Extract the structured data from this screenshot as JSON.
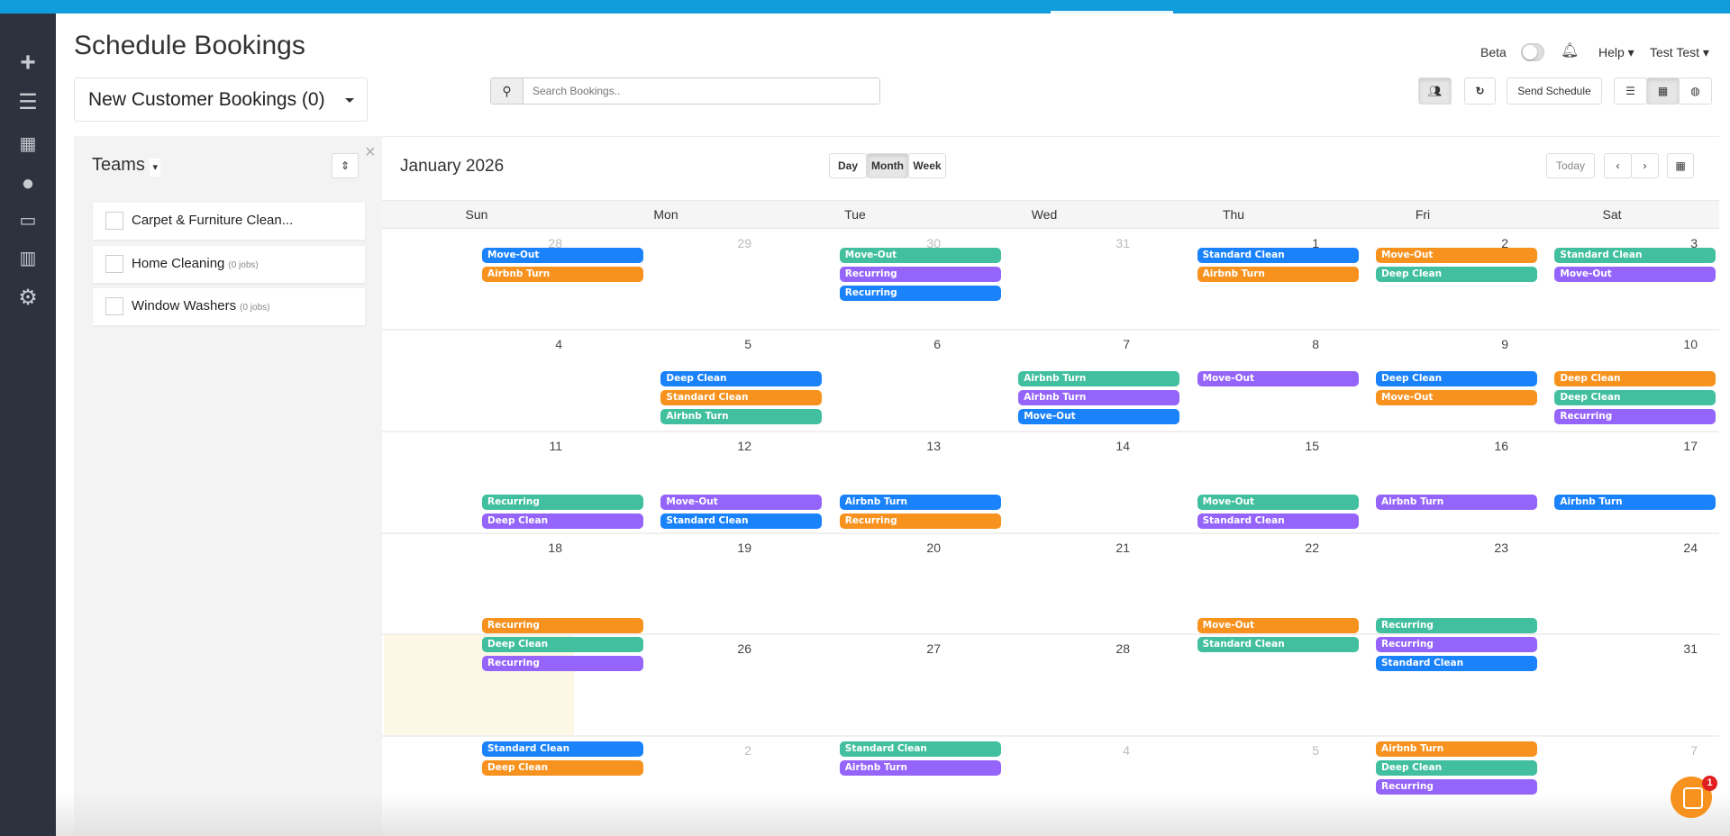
{
  "header": {
    "title": "Schedule Bookings",
    "beta_label": "Beta",
    "help_label": "Help",
    "user_label": "Test Test"
  },
  "new_bookings": {
    "label": "New Customer Bookings (0)"
  },
  "search": {
    "placeholder": "Search Bookings.."
  },
  "toolbar": {
    "send_schedule": "Send Schedule"
  },
  "teams": {
    "title": "Teams",
    "items": [
      {
        "name": "Carpet & Furniture Clean...",
        "jobs": ""
      },
      {
        "name": "Home Cleaning",
        "jobs": "(0 jobs)"
      },
      {
        "name": "Window Washers",
        "jobs": "(0 jobs)"
      }
    ]
  },
  "calendar": {
    "month_title": "January 2026",
    "views": [
      "Day",
      "Month",
      "Week"
    ],
    "active_view": "Month",
    "today_label": "Today",
    "weekdays": [
      "Sun",
      "Mon",
      "Tue",
      "Wed",
      "Thu",
      "Fri",
      "Sat"
    ],
    "colors": {
      "blue": "#1a82fb",
      "orange": "#f7921e",
      "green": "#41bf9f",
      "purple": "#9564fb"
    },
    "weeks": [
      {
        "days": [
          "28",
          "29",
          "30",
          "31",
          "1",
          "2",
          "3"
        ],
        "muted": [
          0,
          1,
          2,
          3
        ],
        "events": [
          [
            0,
            "Move-Out",
            "blue"
          ],
          [
            0,
            "Airbnb Turn",
            "orange"
          ],
          [
            2,
            "Move-Out",
            "green"
          ],
          [
            2,
            "Recurring",
            "purple"
          ],
          [
            2,
            "Recurring",
            "blue"
          ],
          [
            4,
            "Standard Clean",
            "blue"
          ],
          [
            4,
            "Airbnb Turn",
            "orange"
          ],
          [
            5,
            "Move-Out",
            "orange"
          ],
          [
            5,
            "Deep Clean",
            "green"
          ],
          [
            6,
            "Standard Clean",
            "green"
          ],
          [
            6,
            "Move-Out",
            "purple"
          ]
        ]
      },
      {
        "days": [
          "4",
          "5",
          "6",
          "7",
          "8",
          "9",
          "10"
        ],
        "muted": [],
        "events": [
          [
            1,
            "Deep Clean",
            "blue"
          ],
          [
            1,
            "Standard Clean",
            "orange"
          ],
          [
            1,
            "Airbnb Turn",
            "green"
          ],
          [
            3,
            "Airbnb Turn",
            "green"
          ],
          [
            3,
            "Airbnb Turn",
            "purple"
          ],
          [
            3,
            "Move-Out",
            "blue"
          ],
          [
            4,
            "Move-Out",
            "purple"
          ],
          [
            5,
            "Deep Clean",
            "blue"
          ],
          [
            5,
            "Move-Out",
            "orange"
          ],
          [
            6,
            "Deep Clean",
            "orange"
          ],
          [
            6,
            "Deep Clean",
            "green"
          ],
          [
            6,
            "Recurring",
            "purple"
          ]
        ]
      },
      {
        "days": [
          "11",
          "12",
          "13",
          "14",
          "15",
          "16",
          "17"
        ],
        "muted": [],
        "events": [
          [
            0,
            "Recurring",
            "green"
          ],
          [
            0,
            "Deep Clean",
            "purple"
          ],
          [
            1,
            "Move-Out",
            "purple"
          ],
          [
            1,
            "Standard Clean",
            "blue"
          ],
          [
            2,
            "Airbnb Turn",
            "blue"
          ],
          [
            2,
            "Recurring",
            "orange"
          ],
          [
            4,
            "Move-Out",
            "green"
          ],
          [
            4,
            "Standard Clean",
            "purple"
          ],
          [
            5,
            "Airbnb Turn",
            "purple"
          ],
          [
            6,
            "Airbnb Turn",
            "blue"
          ]
        ]
      },
      {
        "days": [
          "18",
          "19",
          "20",
          "21",
          "22",
          "23",
          "24"
        ],
        "muted": [],
        "events": [
          [
            0,
            "Recurring",
            "orange"
          ],
          [
            0,
            "Deep Clean",
            "green"
          ],
          [
            0,
            "Recurring",
            "purple"
          ],
          [
            4,
            "Move-Out",
            "orange"
          ],
          [
            4,
            "Standard Clean",
            "green"
          ],
          [
            5,
            "Recurring",
            "green"
          ],
          [
            5,
            "Recurring",
            "purple"
          ],
          [
            5,
            "Standard Clean",
            "blue"
          ]
        ]
      },
      {
        "days": [
          "",
          "26",
          "27",
          "28",
          "",
          "",
          "31"
        ],
        "muted": [],
        "events": [
          [
            0,
            "Standard Clean",
            "blue"
          ],
          [
            0,
            "Deep Clean",
            "orange"
          ],
          [
            2,
            "Standard Clean",
            "green"
          ],
          [
            2,
            "Airbnb Turn",
            "purple"
          ],
          [
            5,
            "Airbnb Turn",
            "orange"
          ],
          [
            5,
            "Deep Clean",
            "green"
          ],
          [
            5,
            "Recurring",
            "purple"
          ]
        ]
      },
      {
        "days": [
          "",
          "2",
          "",
          "4",
          "5",
          "",
          "7"
        ],
        "muted": [
          1,
          3,
          4,
          6
        ],
        "events": []
      }
    ]
  },
  "chat": {
    "badge": "1"
  }
}
